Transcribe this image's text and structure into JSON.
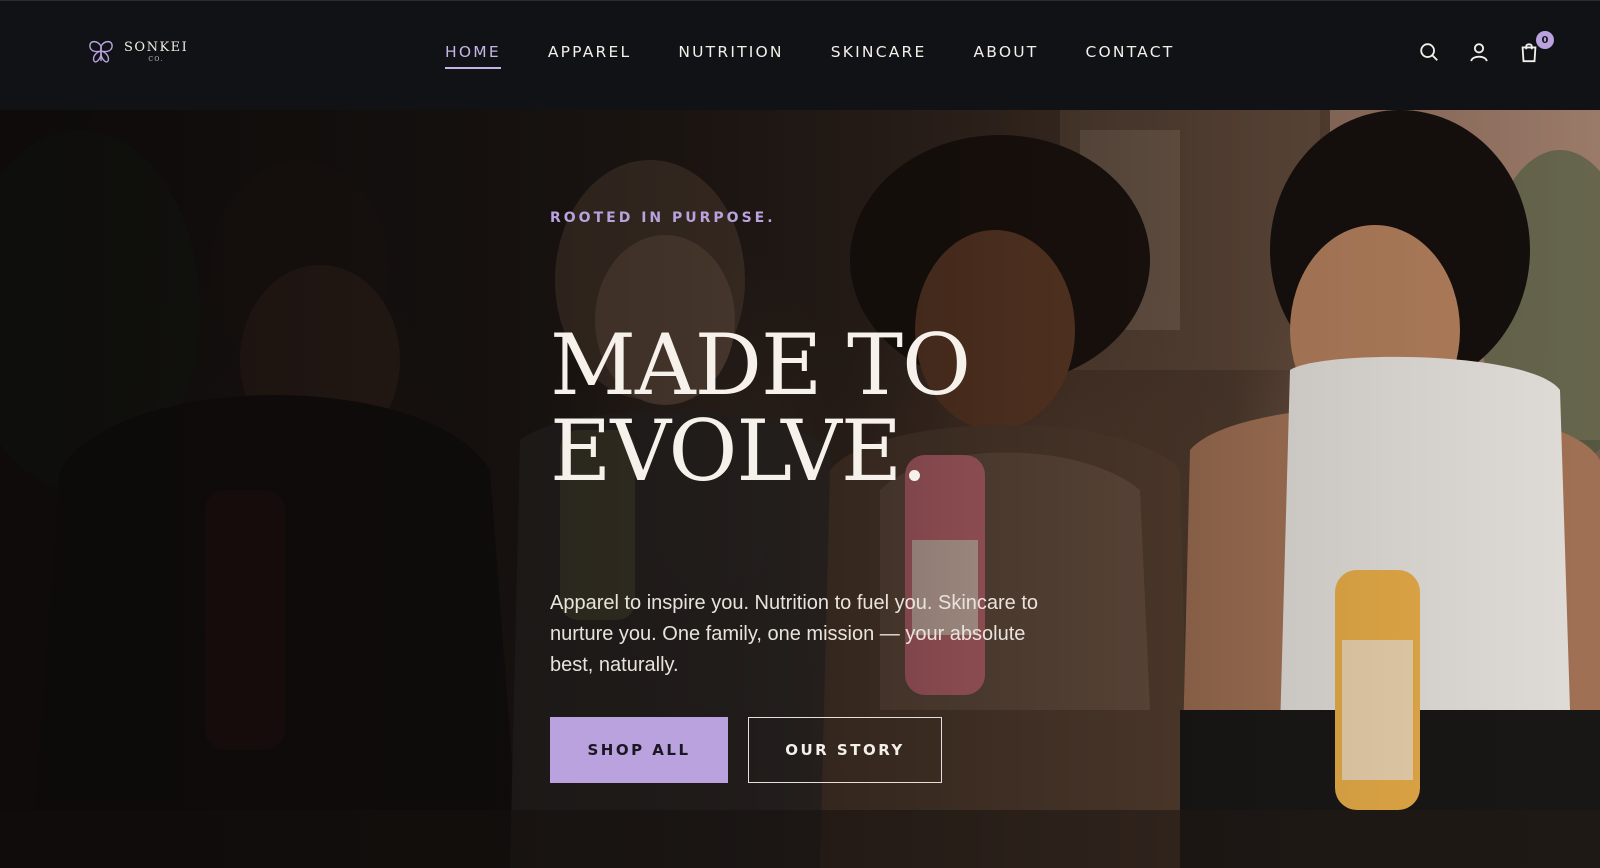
{
  "brand": {
    "name": "SONKEI",
    "sub": "CO."
  },
  "nav": {
    "items": [
      {
        "label": "HOME",
        "active": true
      },
      {
        "label": "APPAREL",
        "active": false
      },
      {
        "label": "NUTRITION",
        "active": false
      },
      {
        "label": "SKINCARE",
        "active": false
      },
      {
        "label": "ABOUT",
        "active": false
      },
      {
        "label": "CONTACT",
        "active": false
      }
    ]
  },
  "header_icons": {
    "search": "search-icon",
    "account": "user-icon",
    "cart": "shopping-bag-icon",
    "cart_count": "0"
  },
  "hero": {
    "eyebrow": "ROOTED IN PURPOSE.",
    "headline_line1": "MADE TO",
    "headline_line2": "EVOLVE.",
    "subtext": "Apparel to inspire you. Nutrition to fuel you. Skincare to nurture you. One family, one mission — your absolute best, naturally.",
    "primary_cta": "SHOP ALL",
    "secondary_cta": "OUR STORY"
  },
  "colors": {
    "accent": "#b9a2dd",
    "header_bg": "#111215",
    "text_light": "#f3efe9"
  }
}
